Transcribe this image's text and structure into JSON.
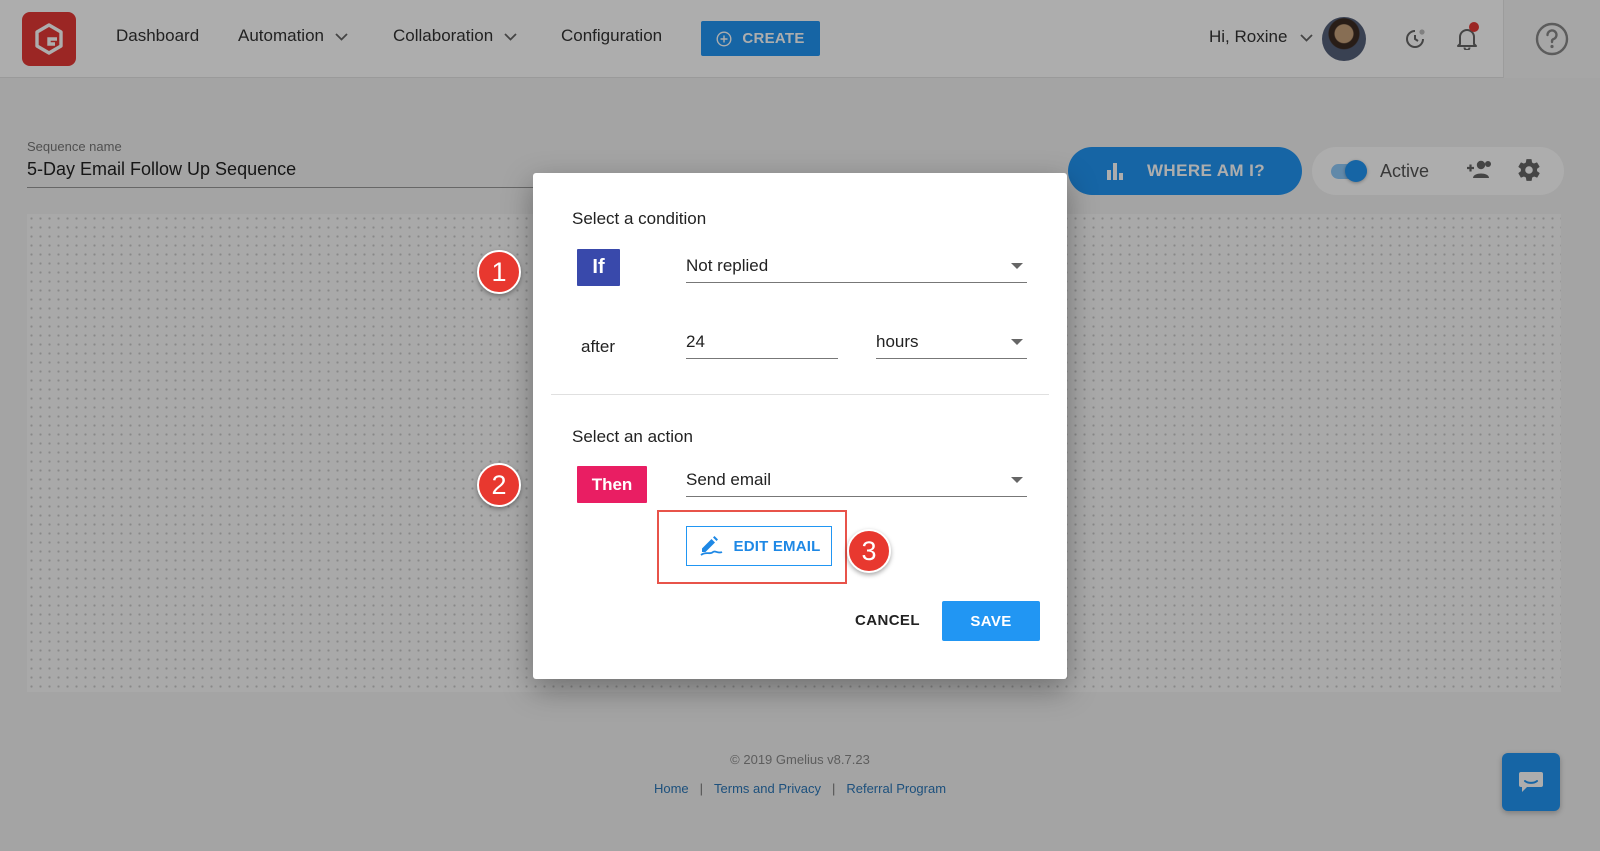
{
  "nav": {
    "items": [
      {
        "label": "Dashboard",
        "has_menu": false
      },
      {
        "label": "Automation",
        "has_menu": true
      },
      {
        "label": "Collaboration",
        "has_menu": true
      },
      {
        "label": "Configuration",
        "has_menu": false
      }
    ],
    "create_label": "CREATE",
    "greeting": "Hi, Roxine"
  },
  "sequence": {
    "name_label": "Sequence name",
    "name_value": "5-Day Email Follow Up Sequence",
    "where_label": "WHERE AM I?",
    "active_label": "Active",
    "active": true
  },
  "dialog": {
    "condition_title": "Select a condition",
    "if_tag": "If",
    "condition_value": "Not replied",
    "after_label": "after",
    "after_value": "24",
    "unit_value": "hours",
    "action_title": "Select an action",
    "then_tag": "Then",
    "action_value": "Send email",
    "edit_email_label": "EDIT EMAIL",
    "cancel_label": "CANCEL",
    "save_label": "SAVE"
  },
  "badges": [
    "1",
    "2",
    "3"
  ],
  "footer": {
    "copyright": "© 2019 Gmelius v8.7.23",
    "links": [
      "Home",
      "Terms and Privacy",
      "Referral Program"
    ]
  },
  "colors": {
    "accent": "#2196f3",
    "if_tag": "#3949ab",
    "then_tag": "#e91e63",
    "badge": "#e8382f",
    "logo": "#e53935"
  }
}
